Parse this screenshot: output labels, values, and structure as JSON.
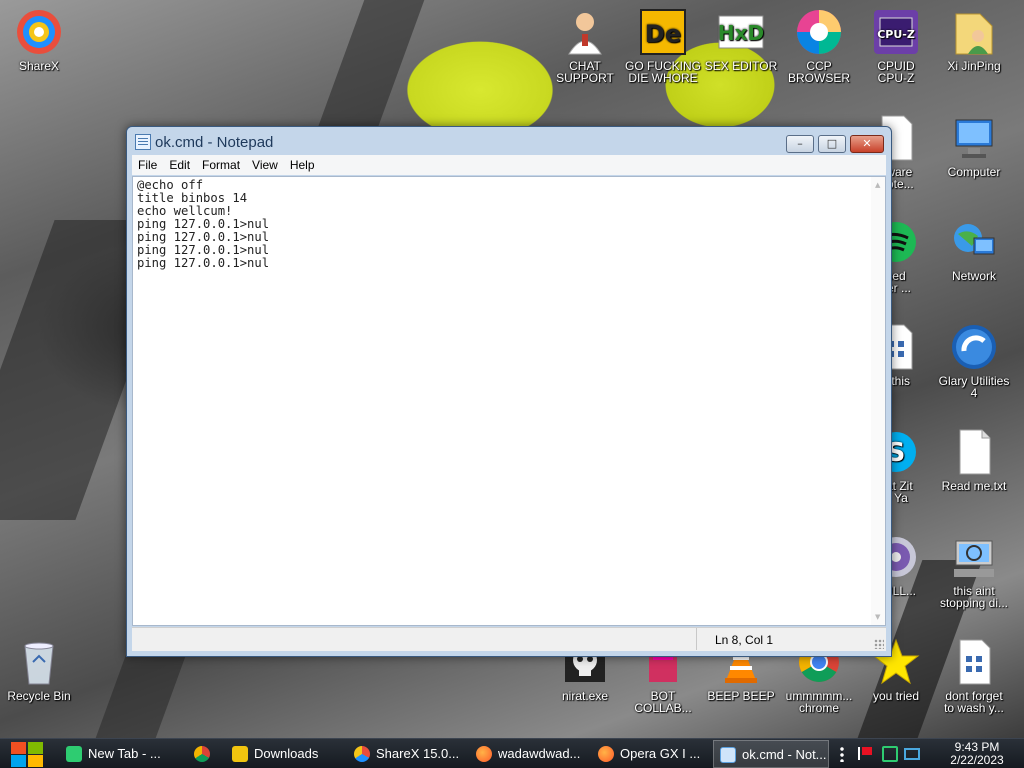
{
  "desktop": {
    "icons": [
      {
        "id": "sharex",
        "label": "ShareX",
        "icon": "sharex-icon"
      },
      {
        "id": "chat-support",
        "label": "CHAT\nSUPPORT",
        "icon": "doctor-icon"
      },
      {
        "id": "go-die",
        "label": "GO FUCKING\nDIE WHORE",
        "icon": "de-icon"
      },
      {
        "id": "sex-editor",
        "label": "SEX EDITOR",
        "icon": "hxd-icon"
      },
      {
        "id": "ccp-browser",
        "label": "CCP\nBROWSER",
        "icon": "ccp-browser-icon"
      },
      {
        "id": "cpuz",
        "label": "CPUID\nCPU-Z",
        "icon": "cpuz-icon"
      },
      {
        "id": "xi-jinping",
        "label": "Xi JinPing",
        "icon": "user-folder-icon"
      },
      {
        "id": "freeware-notes",
        "label": "eware\nNote...",
        "icon": "document-icon"
      },
      {
        "id": "computer",
        "label": "Computer",
        "icon": "computer-icon"
      },
      {
        "id": "based-browser",
        "label": "sed\nser ...",
        "icon": "spotify-icon"
      },
      {
        "id": "network",
        "label": "Network",
        "icon": "network-icon"
      },
      {
        "id": "is-this",
        "label": "s this",
        "icon": "file-icon"
      },
      {
        "id": "glary",
        "label": "Glary Utilities\n4",
        "icon": "glary-icon"
      },
      {
        "id": "what-zit",
        "label": "hat Zit\no Ya",
        "icon": "skype-icon"
      },
      {
        "id": "readme",
        "label": "Read me.txt",
        "icon": "text-file-icon"
      },
      {
        "id": "bull",
        "label": "BULL...",
        "icon": "disc-icon"
      },
      {
        "id": "this-aint",
        "label": "this aint\nstopping di...",
        "icon": "search-computer-icon"
      },
      {
        "id": "recycle-bin",
        "label": "Recycle Bin",
        "icon": "recycle-bin-icon"
      },
      {
        "id": "nirat",
        "label": "nirat.exe",
        "icon": "skull-icon"
      },
      {
        "id": "bot-collab",
        "label": "BOT\nCOLLAB...",
        "icon": "bot-icon"
      },
      {
        "id": "beep-beep",
        "label": "BEEP BEEP",
        "icon": "vlc-icon"
      },
      {
        "id": "ummm-chrome",
        "label": "ummmmm...\nchrome",
        "icon": "chrome-icon"
      },
      {
        "id": "you-tried",
        "label": "you tried",
        "icon": "star-icon"
      },
      {
        "id": "dont-forget",
        "label": "dont forget\nto wash y...",
        "icon": "doc-grid-icon"
      }
    ]
  },
  "notepad": {
    "title": "ok.cmd - Notepad",
    "menu": [
      "File",
      "Edit",
      "Format",
      "View",
      "Help"
    ],
    "content": "@echo off\ntitle binbos 14\necho wellcum!\nping 127.0.0.1>nul\nping 127.0.0.1>nul\nping 127.0.0.1>nul\nping 127.0.0.1>nul",
    "status": "Ln 8, Col 1",
    "buttons": {
      "minimize": "–",
      "maximize": "□",
      "close": "✕"
    }
  },
  "taskbar": {
    "items": [
      {
        "label": "New Tab - ...",
        "icon": "new-tab-icon",
        "color": "#2ecc71"
      },
      {
        "label": "",
        "icon": "chrome-icon",
        "color": "#e74c3c"
      },
      {
        "label": "Downloads",
        "icon": "folder-icon",
        "color": "#f1c40f"
      },
      {
        "label": "ShareX 15.0...",
        "icon": "sharex-icon",
        "color": "#e67e22"
      },
      {
        "label": "wadawdwad...",
        "icon": "firefox-icon",
        "color": "#ff7a18"
      },
      {
        "label": "Opera GX I ...",
        "icon": "firefox-icon",
        "color": "#ff5a2a"
      },
      {
        "label": "ok.cmd - Not...",
        "icon": "notepad-icon",
        "color": "#5aa0e0"
      }
    ],
    "clock": {
      "time": "9:43 PM",
      "date": "2/22/2023"
    }
  },
  "colors": {
    "window_frame": "#c4d6ea",
    "title_text": "#1e395b",
    "taskbar": "#1a2028",
    "close_button": "#c8422a"
  }
}
